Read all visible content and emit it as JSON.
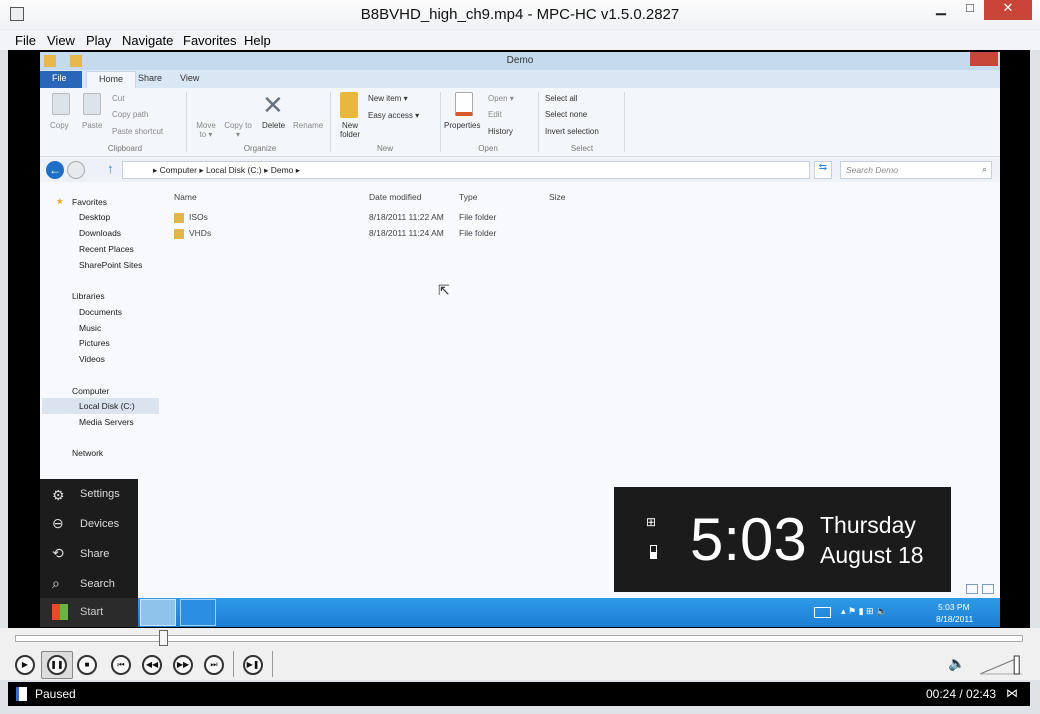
{
  "window": {
    "title": "B8BVHD_high_ch9.mp4 - MPC-HC v1.5.0.2827",
    "minimize": "▁",
    "maximize": "□",
    "close": "✕"
  },
  "menu": [
    "File",
    "View",
    "Play",
    "Navigate",
    "Favorites",
    "Help"
  ],
  "explorer": {
    "title": "Demo",
    "tabs": [
      "File",
      "Home",
      "Share",
      "View"
    ],
    "ribbon": {
      "clipboard": {
        "copy": "Copy",
        "paste": "Paste",
        "cut": "Cut",
        "copy_path": "Copy path",
        "paste_shortcut": "Paste shortcut",
        "label": "Clipboard"
      },
      "organize": {
        "move_to": "Move to ▾",
        "copy_to": "Copy to ▾",
        "delete": "Delete",
        "rename": "Rename",
        "label": "Organize"
      },
      "new": {
        "new_folder": "New folder",
        "new_item": "New item ▾",
        "easy_access": "Easy access ▾",
        "label": "New"
      },
      "open": {
        "properties": "Properties",
        "open": "Open ▾",
        "edit": "Edit",
        "history": "History",
        "label": "Open"
      },
      "select": {
        "select_all": "Select all",
        "select_none": "Select none",
        "invert": "Invert selection",
        "label": "Select"
      }
    },
    "breadcrumb": [
      "Computer",
      "Local Disk (C:)",
      "Demo"
    ],
    "search_placeholder": "Search Demo",
    "nav": {
      "favorites": "Favorites",
      "favorites_items": [
        "Desktop",
        "Downloads",
        "Recent Places",
        "SharePoint Sites"
      ],
      "libraries": "Libraries",
      "libraries_items": [
        "Documents",
        "Music",
        "Pictures",
        "Videos"
      ],
      "computer": "Computer",
      "computer_items": [
        "Local Disk (C:)",
        "Media Servers"
      ],
      "network": "Network"
    },
    "columns": [
      "Name",
      "Date modified",
      "Type",
      "Size"
    ],
    "files": [
      {
        "name": "ISOs",
        "date": "8/18/2011 11:22 AM",
        "type": "File folder"
      },
      {
        "name": "VHDs",
        "date": "8/18/2011 11:24 AM",
        "type": "File folder"
      }
    ]
  },
  "charms": [
    "Settings",
    "Devices",
    "Share",
    "Search"
  ],
  "start": "Start",
  "tray": {
    "time": "5:03 PM",
    "date": "8/18/2011"
  },
  "clock": {
    "time": "5:03",
    "day": "Thursday",
    "date": "August 18"
  },
  "player": {
    "status": "Paused",
    "time": "00:24 / 02:43",
    "progress": 0.147,
    "volume": 0.9
  }
}
